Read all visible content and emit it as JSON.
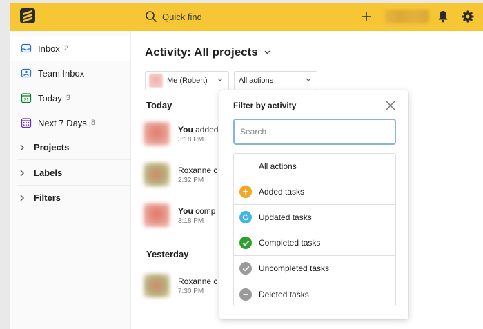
{
  "topbar": {
    "search_label": "Quick find",
    "accent": "#f6c635"
  },
  "sidebar": {
    "items": [
      {
        "label": "Inbox",
        "count": "2",
        "icon": "inbox-icon"
      },
      {
        "label": "Team Inbox",
        "count": "",
        "icon": "team-inbox-icon"
      },
      {
        "label": "Today",
        "count": "3",
        "icon": "calendar-today-icon"
      },
      {
        "label": "Next 7 Days",
        "count": "8",
        "icon": "calendar-week-icon"
      }
    ],
    "groups": [
      {
        "label": "Projects"
      },
      {
        "label": "Labels"
      },
      {
        "label": "Filters"
      }
    ]
  },
  "main": {
    "title": "Activity: All projects",
    "user_filter": "Me (Robert)",
    "action_filter": "All actions",
    "sections": [
      {
        "label": "Today"
      },
      {
        "label": "Yesterday"
      }
    ],
    "activities": [
      {
        "actor": "You",
        "text": " added",
        "time": "3:18 PM"
      },
      {
        "actor": "",
        "text": "Roxanne c",
        "time": "2:32 PM"
      },
      {
        "actor": "You",
        "text": " comp",
        "time": "3:18 PM"
      },
      {
        "actor": "",
        "text": "Roxanne c",
        "time": "7:30 PM"
      }
    ]
  },
  "popup": {
    "title": "Filter by activity",
    "search_placeholder": "Search",
    "options": [
      {
        "label": "All actions",
        "icon": "",
        "color": ""
      },
      {
        "label": "Added tasks",
        "icon": "plus-circle-icon",
        "color": "#f5a623"
      },
      {
        "label": "Updated tasks",
        "icon": "refresh-circle-icon",
        "color": "#3fb5e8"
      },
      {
        "label": "Completed tasks",
        "icon": "check-circle-icon",
        "color": "#2ea02e"
      },
      {
        "label": "Uncompleted tasks",
        "icon": "check-circle-gray-icon",
        "color": "#9a9a9a"
      },
      {
        "label": "Deleted tasks",
        "icon": "minus-circle-icon",
        "color": "#9a9a9a"
      }
    ]
  }
}
